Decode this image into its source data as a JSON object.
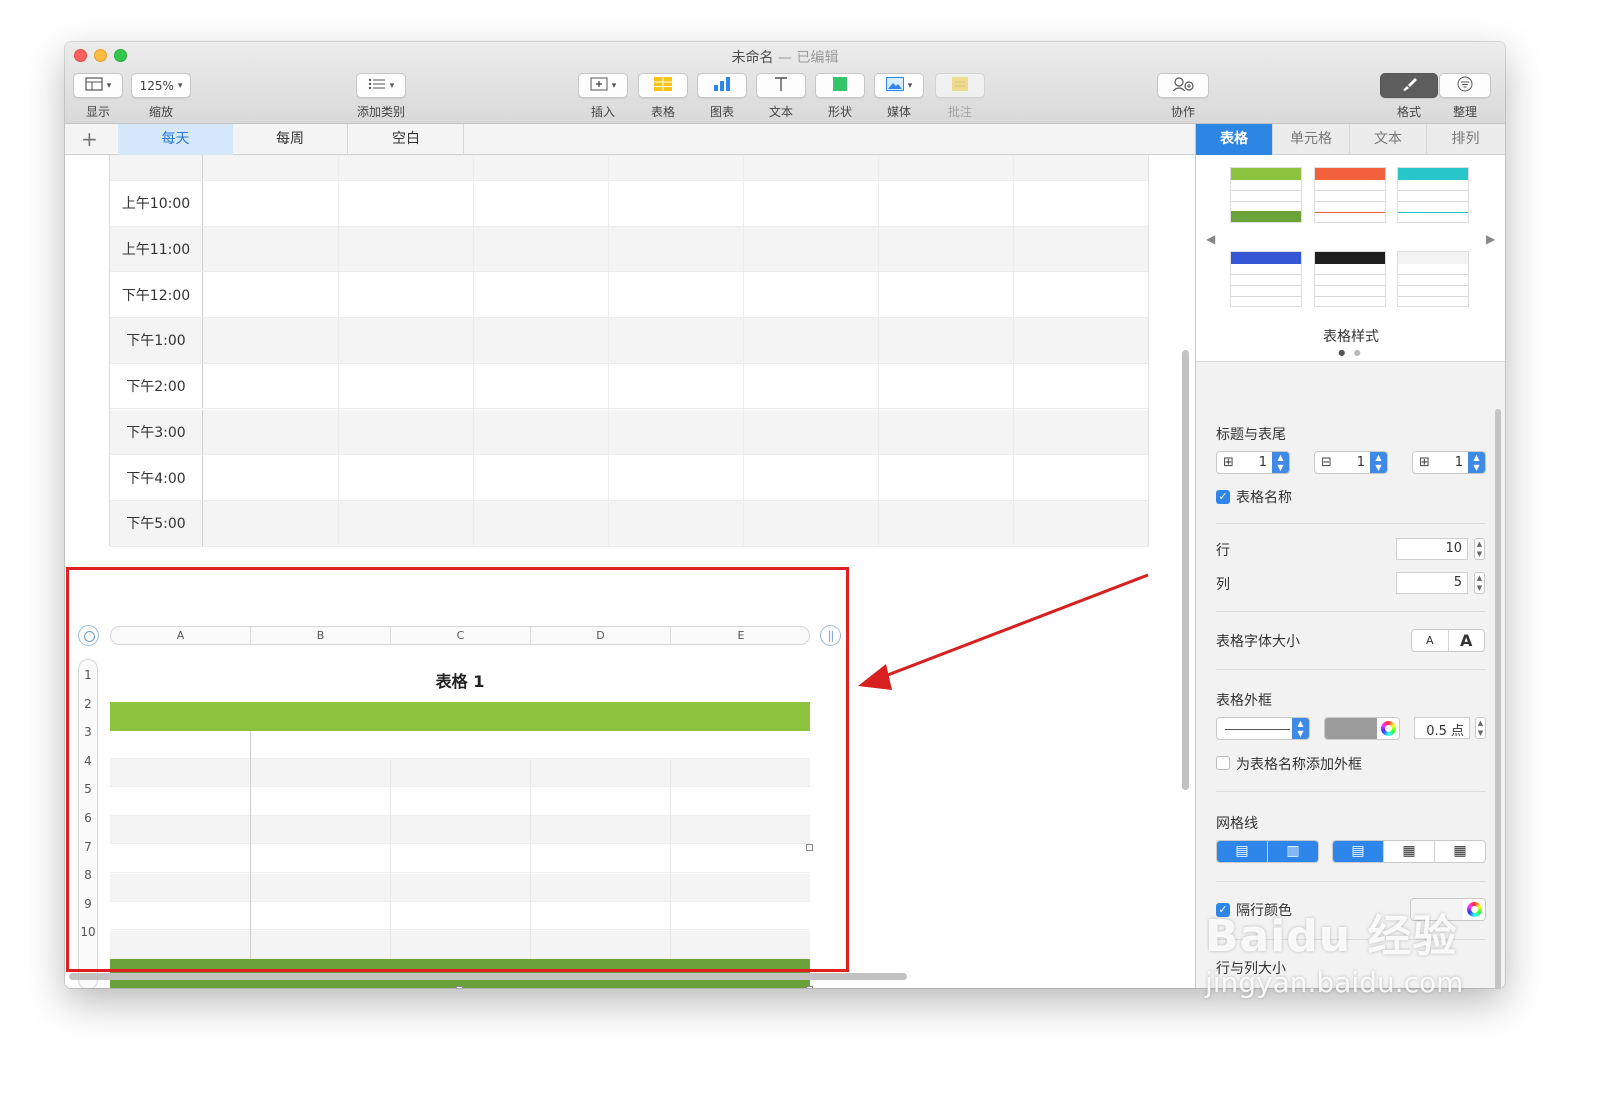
{
  "window": {
    "title": "未命名",
    "edited": "— 已编辑"
  },
  "toolbar": {
    "view": {
      "label": "显示"
    },
    "zoom": {
      "value": "125%",
      "label": "缩放"
    },
    "category": {
      "label": "添加类别"
    },
    "insert": {
      "label": "插入"
    },
    "table": {
      "label": "表格"
    },
    "chart": {
      "label": "图表"
    },
    "text": {
      "label": "文本"
    },
    "shape": {
      "label": "形状"
    },
    "media": {
      "label": "媒体"
    },
    "comment": {
      "label": "批注"
    },
    "collaborate": {
      "label": "协作"
    },
    "format": {
      "label": "格式"
    },
    "organize": {
      "label": "整理"
    }
  },
  "sheets": {
    "add": "+",
    "tabs": [
      "每天",
      "每周",
      "空白"
    ],
    "active": 0
  },
  "schedule": {
    "times": [
      "上午10:00",
      "上午11:00",
      "下午12:00",
      "下午1:00",
      "下午2:00",
      "下午3:00",
      "下午4:00",
      "下午5:00"
    ]
  },
  "table": {
    "title": "表格 1",
    "columns": [
      "A",
      "B",
      "C",
      "D",
      "E"
    ],
    "rows": [
      "1",
      "2",
      "3",
      "4",
      "5",
      "6",
      "7",
      "8",
      "9",
      "10"
    ],
    "header_color": "#8cc43f",
    "footer_color": "#6aa33a"
  },
  "inspector": {
    "tabs": [
      "表格",
      "单元格",
      "文本",
      "排列"
    ],
    "styles_label": "表格样式",
    "swatches": [
      {
        "top": "#8cc43f",
        "bottom": "#6aa33a"
      },
      {
        "top": "#f2603c",
        "bottom": ""
      },
      {
        "top": "#27c7c9",
        "bottom": ""
      },
      {
        "top": "#3557d6",
        "bottom": ""
      },
      {
        "top": "#1f1f1f",
        "bottom": ""
      },
      {
        "top": "#f3f3f3",
        "bottom": ""
      }
    ],
    "headers_footer": {
      "title": "标题与表尾",
      "header_rows": "1",
      "header_cols": "1",
      "footer_rows": "1"
    },
    "table_name": {
      "label": "表格名称",
      "checked": true
    },
    "rows": {
      "label": "行",
      "value": "10"
    },
    "cols": {
      "label": "列",
      "value": "5"
    },
    "font_size": {
      "label": "表格字体大小",
      "small": "A",
      "large": "A"
    },
    "outline": {
      "label": "表格外框",
      "width": "0.5 点",
      "border_color": "#9b9b9b",
      "title_outline": "为表格名称添加外框"
    },
    "gridlines": {
      "label": "网格线"
    },
    "alt_rows": {
      "label": "隔行颜色",
      "checked": true
    },
    "row_col_size": {
      "label": "行与列大小"
    }
  },
  "watermark": {
    "brand": "Baidu 经验",
    "url": "jingyan.baidu.com"
  }
}
